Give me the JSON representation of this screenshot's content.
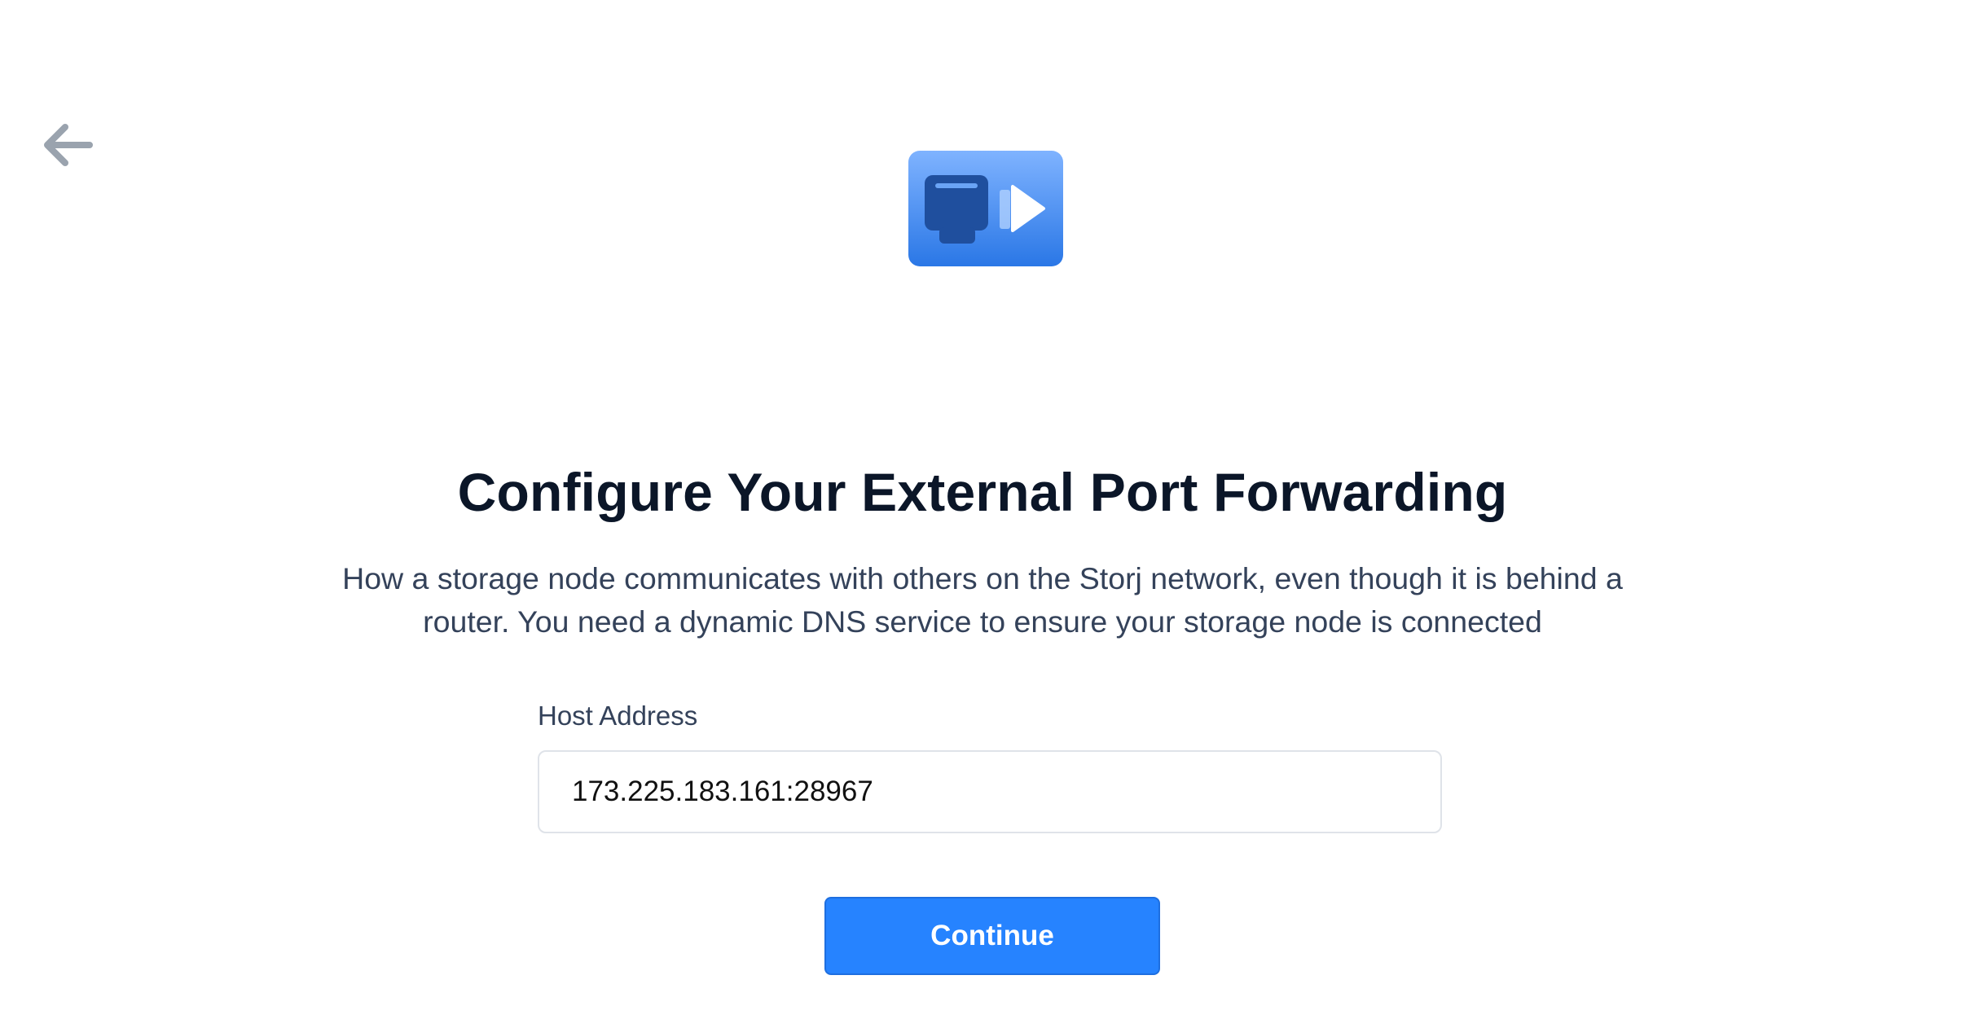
{
  "header": {
    "back_icon": "arrow-left-icon",
    "hero_icon": "port-forwarding-icon"
  },
  "main": {
    "title": "Configure Your External Port Forwarding",
    "description": "How a storage node communicates with others on the Storj network, even though it is behind a router. You need a dynamic DNS service to ensure your storage node is connected",
    "host_address": {
      "label": "Host Address",
      "value": "173.225.183.161:28967"
    },
    "continue_label": "Continue"
  },
  "colors": {
    "accent": "#2683ff",
    "title": "#0b1628",
    "body_text": "#34425a",
    "icon_muted": "#9aa3ae"
  }
}
